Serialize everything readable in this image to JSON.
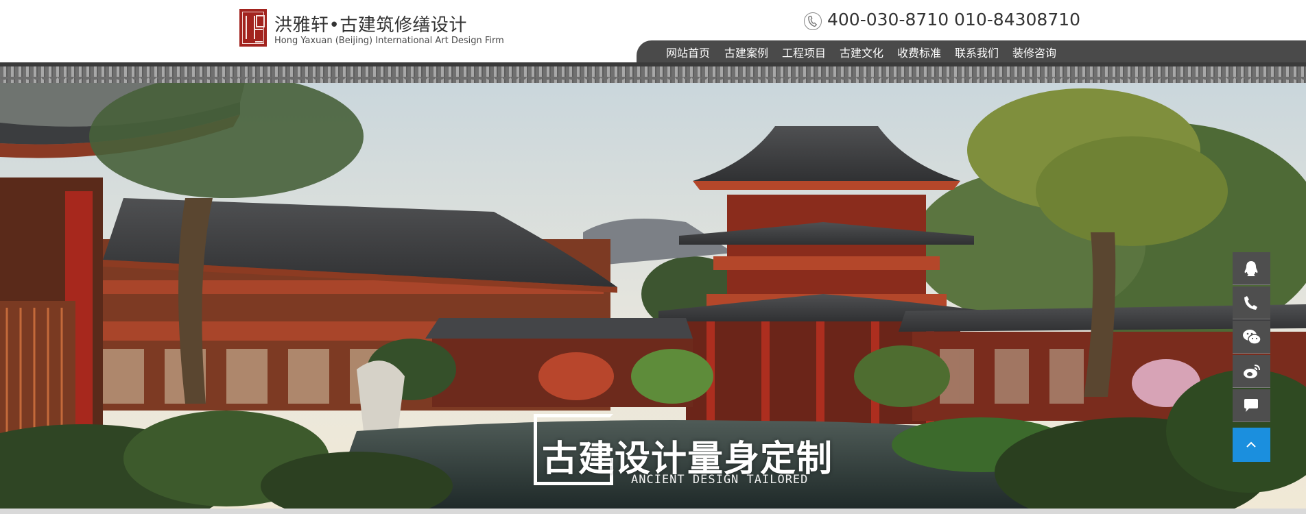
{
  "brand": {
    "title": "洪雅轩•古建筑修缮设计",
    "subtitle": "Hong Yaxuan (Beijing) International Art Design Firm"
  },
  "contact": {
    "phones": "400-030-8710 010-84308710",
    "icon": "phone-icon"
  },
  "nav": {
    "items": [
      {
        "label": "网站首页"
      },
      {
        "label": "古建案例"
      },
      {
        "label": "工程项目"
      },
      {
        "label": "古建文化"
      },
      {
        "label": "收费标准"
      },
      {
        "label": "联系我们"
      },
      {
        "label": "装修咨询"
      }
    ]
  },
  "banner": {
    "slogan": "古建设计量身定制",
    "slogan_en": "ANCIENT DESIGN TAILORED"
  },
  "float_bar": {
    "buttons": [
      {
        "icon": "qq-icon"
      },
      {
        "icon": "phone-icon"
      },
      {
        "icon": "wechat-icon"
      },
      {
        "icon": "weibo-icon"
      },
      {
        "icon": "chat-icon"
      },
      {
        "icon": "chevron-up-icon"
      }
    ]
  },
  "colors": {
    "seal_red": "#a2231e",
    "nav_bg": "#4a4a4a",
    "float_bg": "#4e4e4e",
    "back_to_top_bg": "#1b8fde"
  }
}
